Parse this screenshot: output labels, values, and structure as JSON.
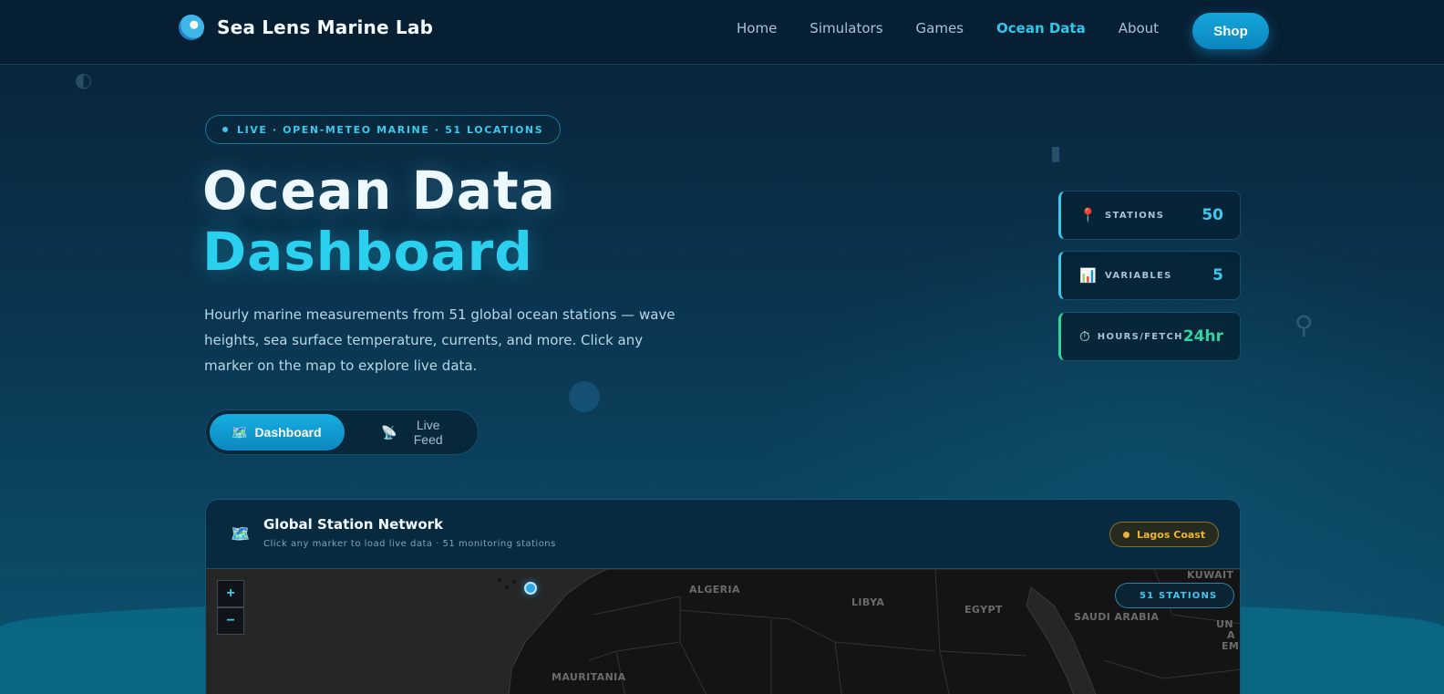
{
  "nav": {
    "brand": "Sea Lens Marine Lab",
    "links": [
      "Home",
      "Simulators",
      "Games",
      "Ocean Data",
      "About"
    ],
    "active_link": "Ocean Data",
    "shop_label": "Shop"
  },
  "hero": {
    "live_label": "LIVE · OPEN-METEO MARINE · 51 LOCATIONS",
    "title_line1": "Ocean Data",
    "title_line2": "Dashboard",
    "description": "Hourly marine measurements from 51 global ocean stations — wave heights, sea surface temperature, currents, and more. Click any marker on the map to explore live data.",
    "toggle": {
      "dashboard_icon": "🗺️",
      "dashboard_label": "Dashboard",
      "live_icon": "📡",
      "live_label": "Live Feed"
    }
  },
  "stats": [
    {
      "icon": "📍",
      "label": "STATIONS",
      "value": "50"
    },
    {
      "icon": "📊",
      "label": "VARIABLES",
      "value": "5"
    },
    {
      "icon": "⏱",
      "label": "HOURS/FETCH",
      "value": "24hr"
    }
  ],
  "map": {
    "icon": "🗺️",
    "title": "Global Station Network",
    "subtitle": "Click any marker to load live data · 51 monitoring stations",
    "selected_location": "Lagos Coast",
    "stations_count_label": "51 STATIONS",
    "zoom_in": "+",
    "zoom_out": "−",
    "countries": [
      "ALGERIA",
      "LIBYA",
      "EGYPT",
      "SAUDI ARABIA",
      "KUWAIT",
      "MAURITANIA",
      "UN",
      "A",
      "EMI"
    ]
  },
  "colors": {
    "accent": "#2fc8ea",
    "green": "#34d39b",
    "badge_gold": "#e9b437",
    "bg_dark": "#071f33"
  }
}
